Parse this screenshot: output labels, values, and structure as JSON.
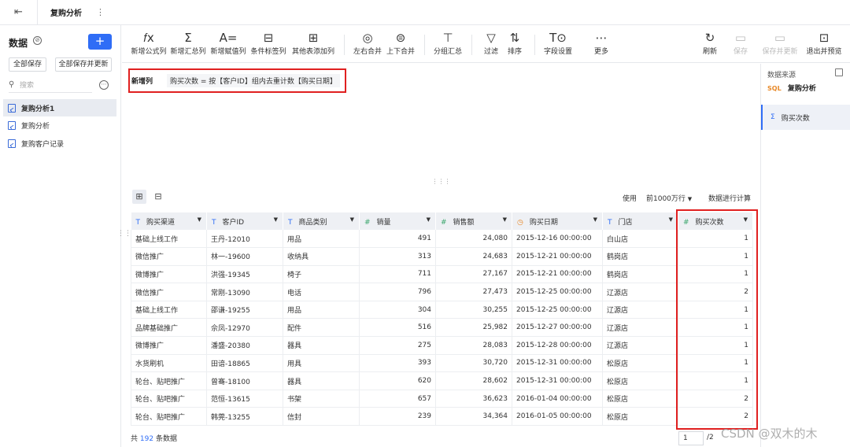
{
  "topbar": {
    "tab_title": "复购分析"
  },
  "left": {
    "header": "数据",
    "add_label": "+",
    "save_all": "全部保存",
    "save_all_update": "全部保存并更新",
    "search_placeholder": "搜索",
    "items": [
      "复购分析1",
      "复购分析",
      "复购客户记录"
    ]
  },
  "toolbar": {
    "tools": [
      {
        "icon": "𝑓x",
        "label": "新增公式列"
      },
      {
        "icon": "Σ",
        "label": "新增汇总列"
      },
      {
        "icon": "A=",
        "label": "新增赋值列"
      },
      {
        "icon": "⊟",
        "label": "条件标签列"
      },
      {
        "icon": "⊞",
        "label": "其他表添加列"
      },
      {
        "icon": "◎",
        "label": "左右合并"
      },
      {
        "icon": "⊜",
        "label": "上下合并"
      },
      {
        "icon": "⊤",
        "label": "分组汇总"
      },
      {
        "icon": "▽",
        "label": "过滤"
      },
      {
        "icon": "⇅",
        "label": "排序"
      },
      {
        "icon": "T⊙",
        "label": "字段设置"
      },
      {
        "icon": "⋯",
        "label": "更多"
      }
    ],
    "right_tools": [
      {
        "icon": "↻",
        "label": "刷新"
      },
      {
        "icon": "▭",
        "label": "保存"
      },
      {
        "icon": "▭",
        "label": "保存并更新"
      },
      {
        "icon": "⊡",
        "label": "退出并预览"
      }
    ]
  },
  "formula": {
    "label": "新增列",
    "expression": "购买次数 = 按【客户ID】组内去重计数【购买日期】"
  },
  "right_panel": {
    "source_label": "数据来源",
    "source_name": "复购分析",
    "source_badge": "SQL",
    "field_name": "购买次数"
  },
  "table_bar": {
    "use": "使用",
    "rows": "前1000万行",
    "calc": "数据进行计算"
  },
  "table": {
    "columns": [
      {
        "type": "T",
        "label": "购买渠道"
      },
      {
        "type": "T",
        "label": "客户ID"
      },
      {
        "type": "T",
        "label": "商品类别"
      },
      {
        "type": "#",
        "label": "销量"
      },
      {
        "type": "#",
        "label": "销售额"
      },
      {
        "type": "◷",
        "label": "购买日期"
      },
      {
        "type": "T",
        "label": "门店"
      },
      {
        "type": "#",
        "label": "购买次数"
      }
    ],
    "rows": [
      [
        "基础上线工作",
        "王丹-12010",
        "用品",
        "491",
        "24,080",
        "2015-12-16 00:00:00",
        "白山店",
        "1"
      ],
      [
        "微信推广",
        "林一-19600",
        "收纳具",
        "313",
        "24,683",
        "2015-12-21 00:00:00",
        "鹤岗店",
        "1"
      ],
      [
        "微博推广",
        "洪强-19345",
        "椅子",
        "711",
        "27,167",
        "2015-12-21 00:00:00",
        "鹤岗店",
        "1"
      ],
      [
        "微信推广",
        "常刚-13090",
        "电话",
        "796",
        "27,473",
        "2015-12-25 00:00:00",
        "辽源店",
        "2"
      ],
      [
        "基础上线工作",
        "邵谦-19255",
        "用品",
        "304",
        "30,255",
        "2015-12-25 00:00:00",
        "辽源店",
        "1"
      ],
      [
        "品牌基础推广",
        "佘凤-12970",
        "配件",
        "516",
        "25,982",
        "2015-12-27 00:00:00",
        "辽源店",
        "1"
      ],
      [
        "微博推广",
        "潘盛-20380",
        "器具",
        "275",
        "28,083",
        "2015-12-28 00:00:00",
        "辽源店",
        "1"
      ],
      [
        "水货刷机",
        "田谙-18865",
        "用具",
        "393",
        "30,720",
        "2015-12-31 00:00:00",
        "松原店",
        "1"
      ],
      [
        "轮台、贴吧推广",
        "曾骞-18100",
        "器具",
        "620",
        "28,602",
        "2015-12-31 00:00:00",
        "松原店",
        "1"
      ],
      [
        "轮台、贴吧推广",
        "范恒-13615",
        "书架",
        "657",
        "36,623",
        "2016-01-04 00:00:00",
        "松原店",
        "2"
      ],
      [
        "轮台、贴吧推广",
        "韩莞-13255",
        "信封",
        "239",
        "34,364",
        "2016-01-05 00:00:00",
        "松原店",
        "2"
      ]
    ]
  },
  "footer": {
    "prefix": "共",
    "count": "192",
    "suffix": "条数据",
    "page": "1",
    "total": "/2"
  },
  "watermark": "CSDN @双木的木"
}
